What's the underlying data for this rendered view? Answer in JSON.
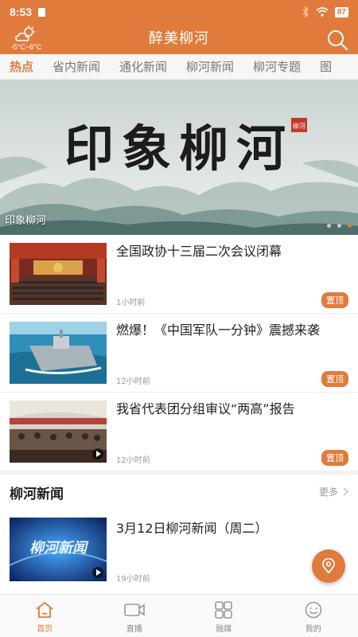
{
  "status_bar": {
    "time": "8:53",
    "battery": "87"
  },
  "header": {
    "title": "醉美柳河",
    "weather_temp": "-5°C~6°C"
  },
  "tabs": [
    {
      "label": "热点",
      "active": true
    },
    {
      "label": "省内新闻",
      "active": false
    },
    {
      "label": "通化新闻",
      "active": false
    },
    {
      "label": "柳河新闻",
      "active": false
    },
    {
      "label": "柳河专题",
      "active": false
    },
    {
      "label": "图",
      "active": false
    }
  ],
  "banner": {
    "caption": "印象柳河",
    "calligraphy": "印象柳河",
    "seal_text": "柳河"
  },
  "news": [
    {
      "headline": "全国政协十三届二次会议闭幕",
      "time": "1小时前",
      "badge": "置顶"
    },
    {
      "headline": "燃爆！《中国军队一分钟》震撼来袭",
      "time": "12小时前",
      "badge": "置顶"
    },
    {
      "headline": "我省代表团分组审议“两高”报告",
      "time": "12小时前",
      "badge": "置顶"
    }
  ],
  "section": {
    "title": "柳河新闻",
    "more_label": "更多"
  },
  "section_news": [
    {
      "headline": "3月12日柳河新闻（周二）",
      "time": "19小时前",
      "thumb_text": "柳河新闻"
    }
  ],
  "bottom_nav": [
    {
      "label": "首页",
      "icon": "home-icon",
      "active": true
    },
    {
      "label": "直播",
      "icon": "video-camera-icon",
      "active": false
    },
    {
      "label": "融媒",
      "icon": "grid-icon",
      "active": false
    },
    {
      "label": "我的",
      "icon": "smile-face-icon",
      "active": false
    }
  ],
  "colors": {
    "accent": "#e07b3c"
  }
}
